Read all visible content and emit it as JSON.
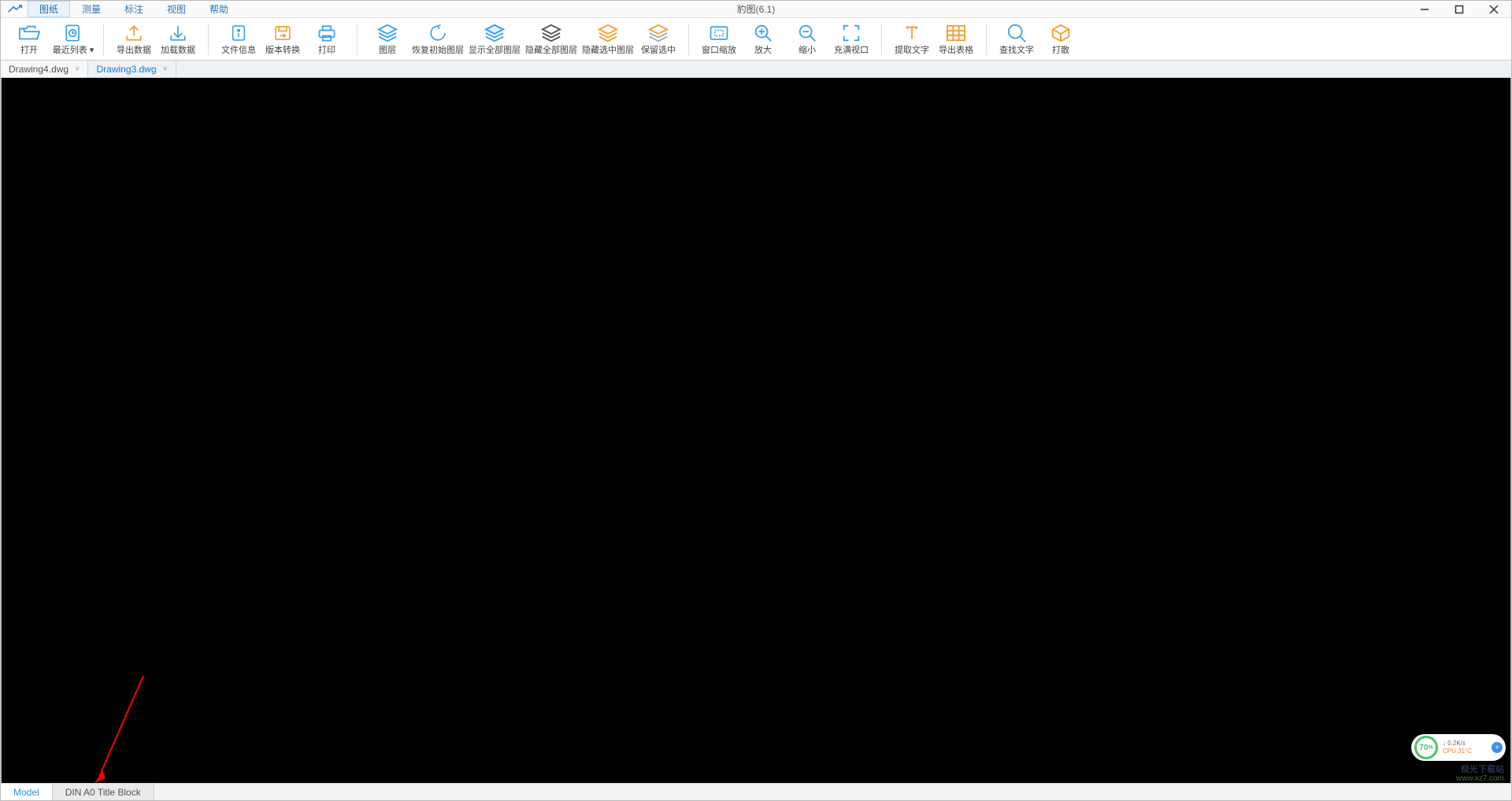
{
  "app": {
    "title": "豹图(6.1)"
  },
  "menu": {
    "tabs": [
      {
        "label": "图纸",
        "active": true
      },
      {
        "label": "测量"
      },
      {
        "label": "标注"
      },
      {
        "label": "视图"
      },
      {
        "label": "帮助"
      }
    ]
  },
  "ribbon": {
    "open": "打开",
    "recent": "最近列表 ▾",
    "export": "导出数据",
    "load": "加载数据",
    "fileinfo": "文件信息",
    "versionconv": "版本转换",
    "print": "打印",
    "layer": "图层",
    "restorelayer": "恢复初始图层",
    "showall": "显示全部图层",
    "hideall": "隐藏全部图层",
    "hidesel": "隐藏选中图层",
    "keepsel": "保留选中",
    "fitwindow": "窗口缩放",
    "zoomin": "放大",
    "zoomout": "缩小",
    "fillview": "充满视口",
    "extracttext": "提取文字",
    "exporttable": "导出表格",
    "findtext": "查找文字",
    "scatter": "打散"
  },
  "filetabs": [
    {
      "label": "Drawing4.dwg",
      "active": true
    },
    {
      "label": "Drawing3.dwg",
      "active": false,
      "highlight": true
    }
  ],
  "layouttabs": [
    {
      "label": "Model",
      "active": true
    },
    {
      "label": "DIN A0 Title Block",
      "active": false
    }
  ],
  "perf": {
    "percent": "70",
    "pct_suffix": "%",
    "net": "↓ 0.2K/s",
    "cpu": "CPU 31°C"
  },
  "watermark": {
    "line1": "极光下载站",
    "line2": "www.xz7.com"
  }
}
